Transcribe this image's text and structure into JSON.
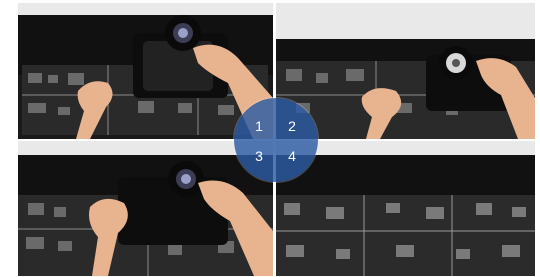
{
  "steps": {
    "n1": "1",
    "n2": "2",
    "n3": "3",
    "n4": "4"
  },
  "colors": {
    "badge": "#2d5ca5",
    "panel": "#1c1c1c",
    "wall": "#e6e6e6",
    "skin": "#e8b48f"
  },
  "icons": {
    "tool": "cleaning-blower-tool-icon"
  }
}
